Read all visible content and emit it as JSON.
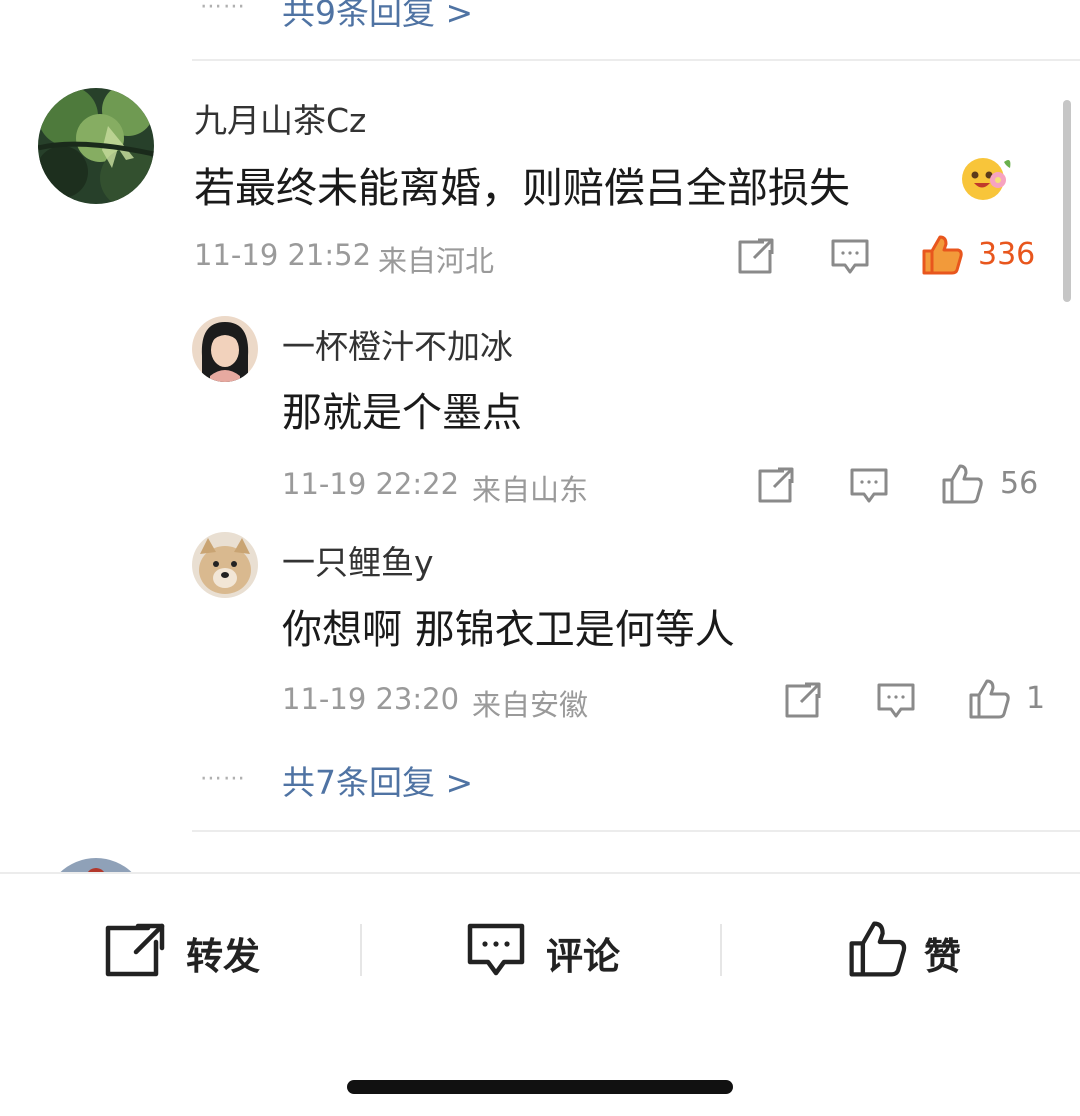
{
  "top_more_replies": "共9条回复 >",
  "comment": {
    "username": "九月山茶Cz",
    "text": "若最终未能离婚，则赔偿吕全部损失",
    "emoji_icon": "flower-blush-emoji",
    "time": "11-19 21:52",
    "location": "来自河北",
    "likes": "336",
    "accent_color": "#e8561d"
  },
  "replies": [
    {
      "username": "一杯橙汁不加冰",
      "text": "那就是个墨点",
      "time": "11-19 22:22",
      "location": "来自山东",
      "likes": "56"
    },
    {
      "username": "一只鲤鱼y",
      "text": "你想啊 那锦衣卫是何等人",
      "time": "11-19 23:20",
      "location": "来自安徽",
      "likes": "1"
    }
  ],
  "more_replies": "共7条回复 >",
  "bottom_bar": {
    "repost": "转发",
    "comment": "评论",
    "like": "赞"
  },
  "colors": {
    "link": "#4f73a3",
    "meta": "#9a9a9a"
  }
}
